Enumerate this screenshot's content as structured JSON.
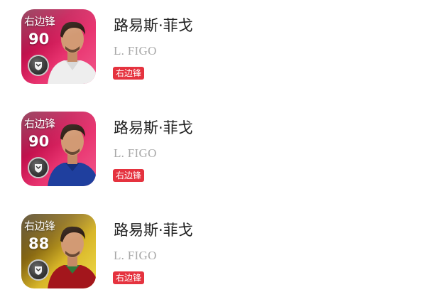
{
  "players": [
    {
      "card_position": "右边锋",
      "rating": "90",
      "name_cn": "路易斯·菲戈",
      "name_en": "L. FIGO",
      "position_tag": "右边锋",
      "card_style": "pink",
      "kit_color": "#eeeeee"
    },
    {
      "card_position": "右边锋",
      "rating": "90",
      "name_cn": "路易斯·菲戈",
      "name_en": "L. FIGO",
      "position_tag": "右边锋",
      "card_style": "pink",
      "kit_color": "#1f3f9e"
    },
    {
      "card_position": "右边锋",
      "rating": "88",
      "name_cn": "路易斯·菲戈",
      "name_en": "L. FIGO",
      "position_tag": "右边锋",
      "card_style": "gold",
      "kit_color": "#a3161c"
    }
  ],
  "colors": {
    "tag_background": "#e5333f",
    "name_text": "#222222",
    "english_name_text": "#a8a8a8"
  }
}
